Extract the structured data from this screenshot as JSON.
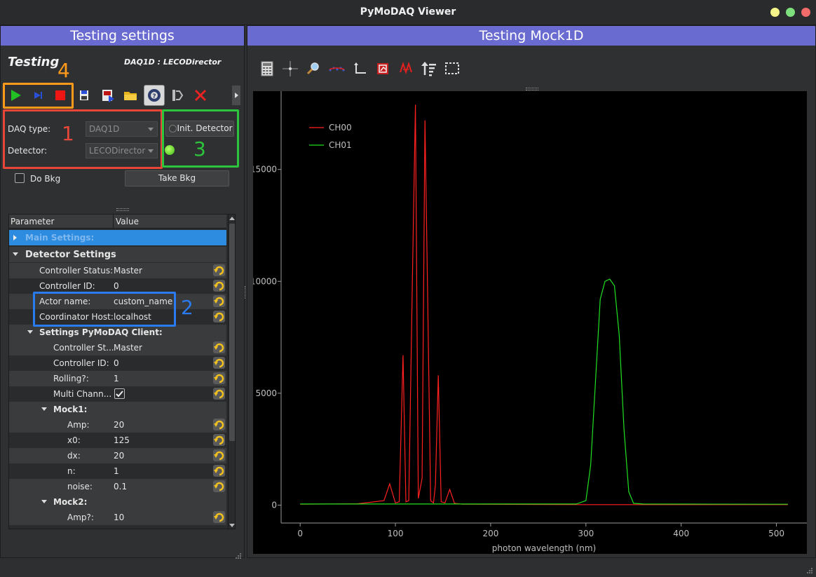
{
  "window": {
    "title": "PyMoDAQ Viewer"
  },
  "left_dock": {
    "title": "Testing settings",
    "viewer_title": "Testing",
    "daq_info": "DAQ1D : LECODirector",
    "annotations": [
      "1",
      "2",
      "3",
      "4"
    ],
    "daq_type_label": "DAQ type:",
    "daq_type_value": "DAQ1D",
    "detector_label": "Detector:",
    "detector_value": "LECODirector",
    "init_detector_label": "Init. Detector",
    "do_bkg_label": "Do Bkg",
    "take_bkg_label": "Take Bkg",
    "tree": {
      "headers": [
        "Parameter",
        "Value"
      ],
      "main_settings": "Main Settings:",
      "detector_settings": "Detector Settings",
      "controller_status_label": "Controller Status:",
      "controller_status_value": "Master",
      "controller_id_label": "Controller ID:",
      "controller_id_value": "0",
      "actor_name_label": "Actor name:",
      "actor_name_value": "custom_name",
      "coordinator_host_label": "Coordinator Host:",
      "coordinator_host_value": "localhost",
      "pymodaq_client": "Settings PyMoDAQ Client:",
      "controller_st_label": "Controller St...",
      "controller_st_value": "Master",
      "controller_id2_label": "Controller ID:",
      "controller_id2_value": "0",
      "rolling_label": "Rolling?:",
      "rolling_value": "1",
      "multi_channel_label": "Multi Chann...",
      "multi_channel_checked": true,
      "mock1": "Mock1:",
      "amp_label": "Amp:",
      "amp_value": "20",
      "x0_label": "x0:",
      "x0_value": "125",
      "dx_label": "dx:",
      "dx_value": "20",
      "n_label": "n:",
      "n_value": "1",
      "noise_label": "noise:",
      "noise_value": "0.1",
      "mock2": "Mock2:",
      "amp2_label": "Amp?:",
      "amp2_value": "10"
    }
  },
  "right_dock": {
    "title": "Testing Mock1D"
  },
  "chart_data": {
    "type": "line",
    "xlabel": "photon wavelength (nm)",
    "ylabel": "",
    "xlim": [
      -20,
      532
    ],
    "ylim": [
      -800,
      18500
    ],
    "xticks": [
      0,
      100,
      200,
      300,
      400,
      500
    ],
    "yticks": [
      0,
      5000,
      10000,
      15000
    ],
    "legend_position": "top-left",
    "series": [
      {
        "name": "CH00",
        "color": "#ff2020",
        "x": [
          0,
          60,
          88,
          94,
          100,
          104,
          108,
          111,
          114,
          118,
          121,
          124,
          128,
          131,
          134,
          137,
          140,
          142,
          145,
          148,
          152,
          157,
          162,
          170,
          300,
          512
        ],
        "y": [
          40,
          60,
          200,
          950,
          100,
          150,
          6700,
          150,
          200,
          10500,
          17900,
          300,
          1200,
          17200,
          9000,
          200,
          100,
          900,
          5800,
          150,
          100,
          700,
          80,
          40,
          20,
          20
        ]
      },
      {
        "name": "CH01",
        "color": "#20e020",
        "x": [
          0,
          290,
          300,
          305,
          310,
          315,
          320,
          325,
          330,
          335,
          340,
          345,
          350,
          360,
          512
        ],
        "y": [
          50,
          50,
          200,
          1800,
          5500,
          9200,
          10000,
          10100,
          9800,
          7600,
          3400,
          600,
          80,
          50,
          40
        ]
      }
    ]
  }
}
